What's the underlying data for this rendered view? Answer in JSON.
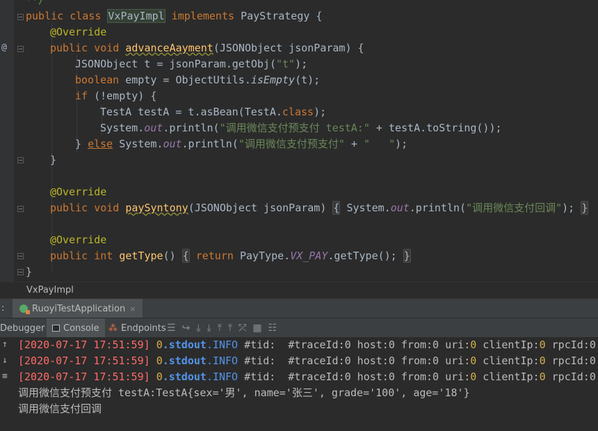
{
  "editor": {
    "gutter_marker": "@",
    "lines": {
      "l0": "**/",
      "l1": {
        "kw_public_class": "public class ",
        "class_name": "VxPayImpl",
        "kw_implements": " implements ",
        "iface": "PayStrategy {"
      },
      "l2": "@Override",
      "l3": {
        "kw": "public void ",
        "fn": "advanceAayment",
        "rest": "(JSONObject jsonParam) {"
      },
      "l4": {
        "a": "JSONObject t = jsonParam.getObj(",
        "s": "\"t\"",
        "b": ");"
      },
      "l5": {
        "kw": "boolean ",
        "a": "empty = ObjectUtils.",
        "it": "isEmpty",
        "b": "(t);"
      },
      "l6": {
        "kw": "if ",
        "a": "(!empty) {"
      },
      "l7": {
        "a": "TestA testA = t.asBean(TestA.",
        "kw": "class",
        "b": ");"
      },
      "l8": {
        "a": "System.",
        "it": "out",
        "b": ".println(",
        "s": "\"调用微信支付预支付 testA:\"",
        "c": " + testA.toString());"
      },
      "l9": {
        "a": "} ",
        "kw": "else",
        "b": " System.",
        "it": "out",
        "c": ".println(",
        "s": "\"调用微信支付预支付\"",
        "d": " + ",
        "s2": "\"   \"",
        "e": ");"
      },
      "l10": "}",
      "l12": "@Override",
      "l13": {
        "kw": "public void ",
        "fn": "paySyntony",
        "rest": "(JSONObject jsonParam) ",
        "f1": "{",
        "a": " System.",
        "it": "out",
        "b": ".println(",
        "s": "\"调用微信支付回调\"",
        "c": "); ",
        "f2": "}"
      },
      "l15": "@Override",
      "l16": {
        "kw": "public int ",
        "fn": "getType",
        "rest": "() ",
        "f1": "{",
        "kw2": " return ",
        "a": "PayType.",
        "it": "VX_PAY",
        "b": ".getType(); ",
        "f2": "}"
      },
      "l17": "}"
    }
  },
  "breadcrumb": {
    "label": "VxPayImpl"
  },
  "run_panel": {
    "colon": ":",
    "tab_label": "RuoyiTestApplication",
    "close": "×"
  },
  "toolbar": {
    "debugger": "Debugger",
    "console": "Console",
    "endpoints": "Endpoints"
  },
  "console": {
    "log_lines": [
      {
        "ts": "[2020-07-17 17:51:59]",
        "n": "0",
        "stdout": ".stdout",
        "info": ".INFO",
        "rest1": " #tid:  #traceId:0 host:0 from:0 uri:",
        "z": "0",
        "rest2": " clientIp:",
        "z2": "0",
        "rest3": " rpcId:0"
      },
      {
        "ts": "[2020-07-17 17:51:59]",
        "n": "0",
        "stdout": ".stdout",
        "info": ".INFO",
        "rest1": " #tid:  #traceId:0 host:0 from:0 uri:",
        "z": "0",
        "rest2": " clientIp:",
        "z2": "0",
        "rest3": " rpcId:0"
      },
      {
        "ts": "[2020-07-17 17:51:59]",
        "n": "0",
        "stdout": ".stdout",
        "info": ".INFO",
        "rest1": " #tid:  #traceId:0 host:0 from:0 uri:",
        "z": "0",
        "rest2": " clientIp:",
        "z2": "0",
        "rest3": " rpcId:0"
      }
    ],
    "out1": "调用微信支付预支付 testA:TestA{sex='男', name='张三', grade='100', age='18'}",
    "out2": "调用微信支付回调"
  }
}
